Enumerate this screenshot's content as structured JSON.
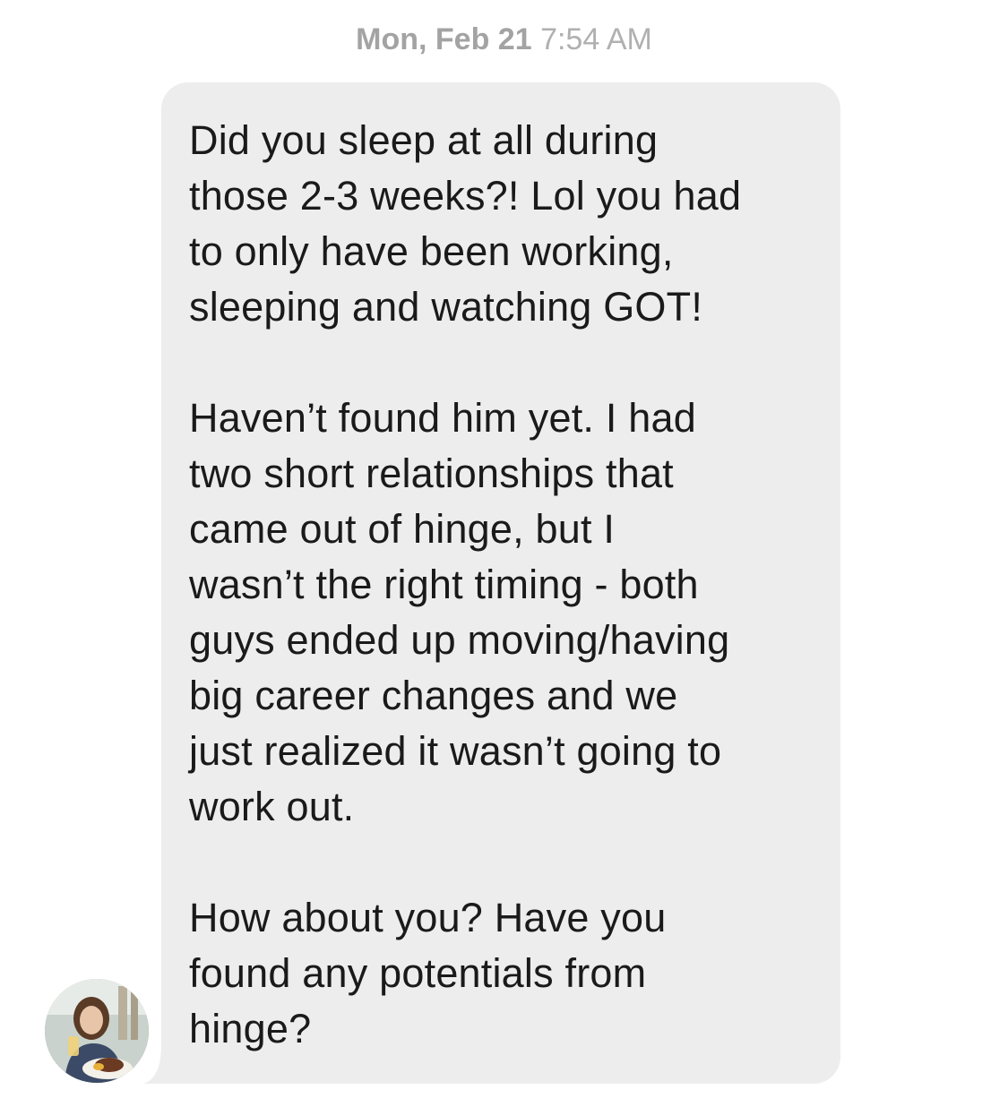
{
  "timestamp": {
    "date": "Mon, Feb 21",
    "time": "7:54 AM"
  },
  "message": {
    "sender_avatar_icon": "avatar-photo",
    "bubble_color": "#ededed",
    "paragraphs": [
      {
        "lines": [
          "Did you sleep at all during",
          "those 2-3 weeks?! Lol you had",
          "to only have been working,",
          "sleeping and watching GOT!"
        ]
      },
      {
        "lines": [
          "Haven’t found him yet. I had",
          "two short relationships that",
          "came out of hinge, but I",
          "wasn’t the right timing - both",
          "guys ended up moving/having",
          "big career changes and we",
          "just realized it wasn’t going to",
          "work out."
        ]
      },
      {
        "lines": [
          "How about you? Have you",
          "found any potentials from",
          "hinge?"
        ]
      }
    ]
  }
}
